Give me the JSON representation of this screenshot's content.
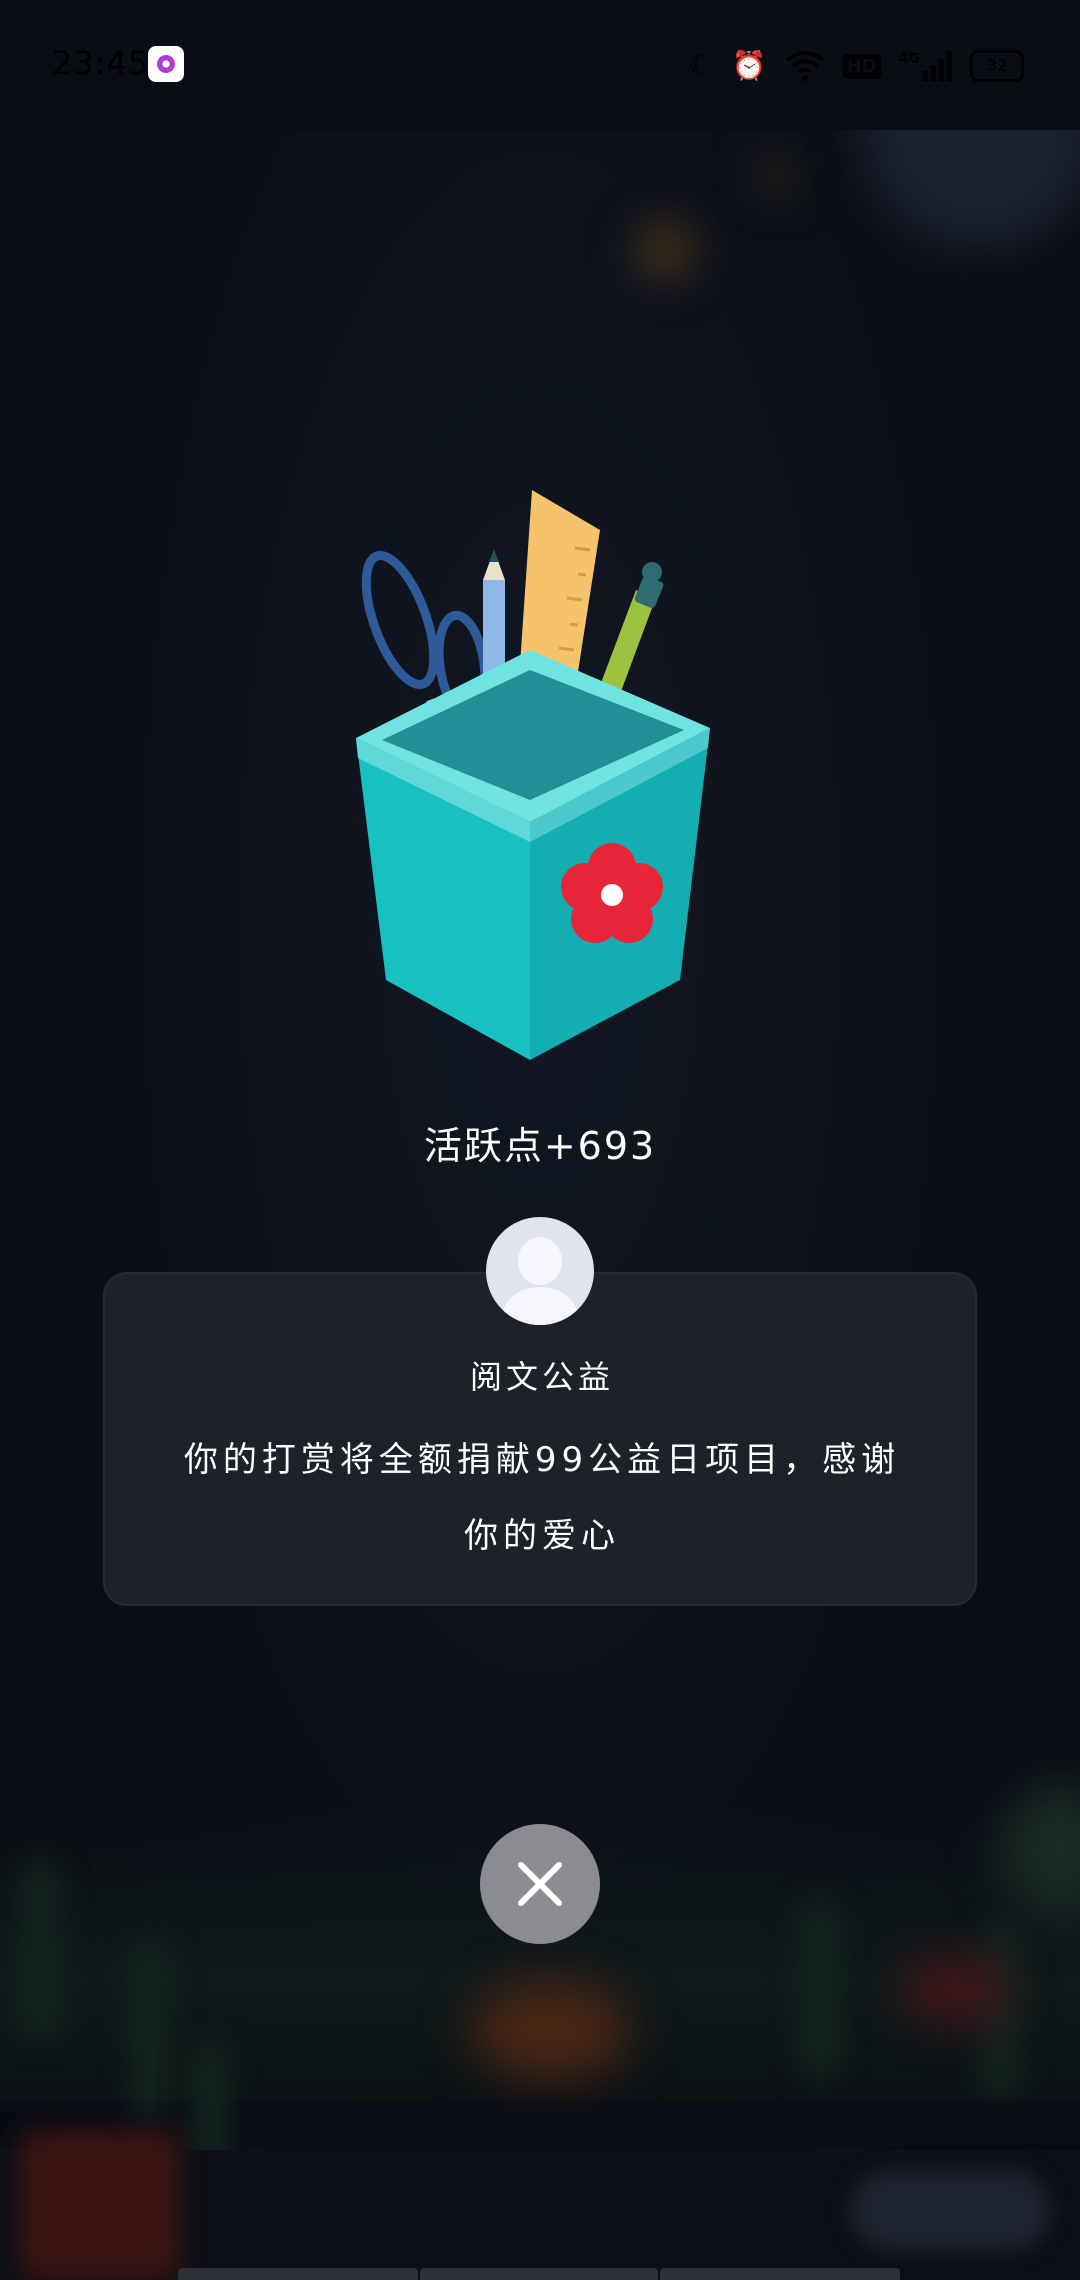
{
  "status_bar": {
    "time": "23:45",
    "network": "4G",
    "hd": "HD",
    "battery": "32"
  },
  "reward": {
    "points_text": "活跃点+693"
  },
  "card": {
    "title": "阅文公益",
    "message": "你的打赏将全额捐献99公益日项目，感谢你的爱心"
  },
  "colors": {
    "background": "#0b0f17",
    "card": "#1d2129",
    "close_button": "#8a8c90",
    "text": "#ffffff"
  },
  "icons": [
    "app-notification-icon",
    "moon-icon",
    "alarm-icon",
    "wifi-icon",
    "hd-icon",
    "signal-icon",
    "battery-icon",
    "avatar-icon",
    "close-icon",
    "pencil-holder-illustration"
  ]
}
